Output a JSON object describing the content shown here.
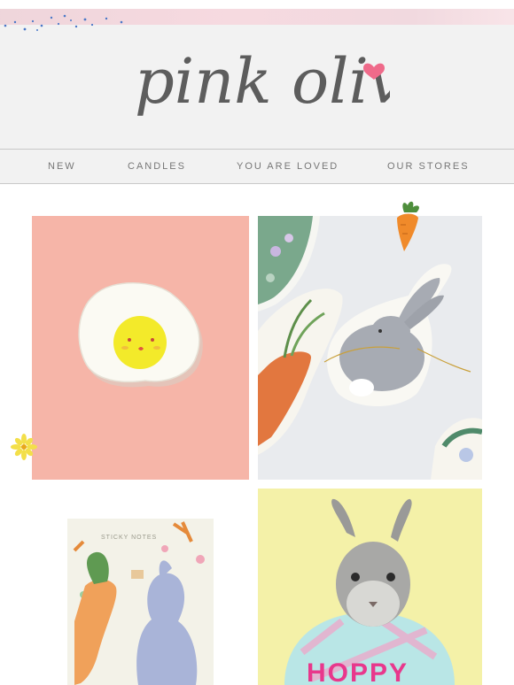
{
  "brand": {
    "name": "pink olive",
    "text_color": "#5d5d5d",
    "heart_color": "#ef6a8a"
  },
  "nav": {
    "items": [
      {
        "label": "NEW"
      },
      {
        "label": "CANDLES"
      },
      {
        "label": "YOU ARE LOVED"
      },
      {
        "label": "OUR STORES"
      }
    ]
  },
  "products": [
    {
      "name": "egg-chick-pin",
      "background": "#f6b5a8"
    },
    {
      "name": "bunny-garland",
      "background": "#e9ebee"
    },
    {
      "name": "easter-sticky-notes",
      "background": "#ffffff",
      "card_heading": "STICKY NOTES"
    },
    {
      "name": "hoppy-bunny-card",
      "background": "#f4f1a8",
      "card_text": "HOPPY"
    }
  ],
  "decorations": {
    "carrot_icon": "carrot-icon",
    "flower_icon": "flower-icon"
  }
}
